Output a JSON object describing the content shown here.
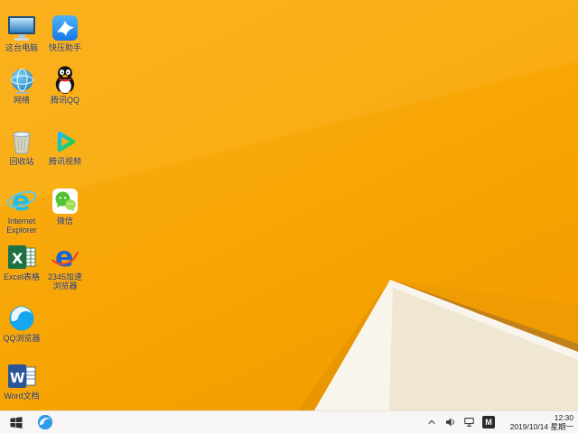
{
  "desktop": {
    "icons": [
      {
        "name": "this-pc",
        "label": "这台电脑"
      },
      {
        "name": "network",
        "label": "网络"
      },
      {
        "name": "recycle-bin",
        "label": "回收站"
      },
      {
        "name": "internet-explorer",
        "label": "Internet Explorer"
      },
      {
        "name": "excel",
        "label": "Excel表格"
      },
      {
        "name": "qq-browser",
        "label": "QQ浏览器"
      },
      {
        "name": "word",
        "label": "Word文档"
      },
      {
        "name": "kuaiya",
        "label": "快压助手"
      },
      {
        "name": "tencent-qq",
        "label": "腾讯QQ"
      },
      {
        "name": "tencent-video",
        "label": "腾讯视频"
      },
      {
        "name": "wechat",
        "label": "微信"
      },
      {
        "name": "browser-2345",
        "label": "2345加速浏览器"
      }
    ]
  },
  "icon_glyphs": {
    "ie": "e",
    "excel": "X",
    "word": "W",
    "browser_2345": "e"
  },
  "taskbar": {
    "input_indicator": "M",
    "clock": {
      "time": "12:30",
      "date": "2019/10/14 星期一"
    }
  },
  "colors": {
    "wallpaper_orange": "#F7A400",
    "wallpaper_white_facet": "#F8F5EC",
    "wallpaper_edge": "#C2801A",
    "taskbar_bg": "#F7F6F4",
    "icon_label_text": "#24356B",
    "ie_blue": "#1EBBEE",
    "excel_green": "#1E7145",
    "word_blue": "#2B579A",
    "wechat_green": "#51C332",
    "qq_scarf_red": "#E62129"
  }
}
